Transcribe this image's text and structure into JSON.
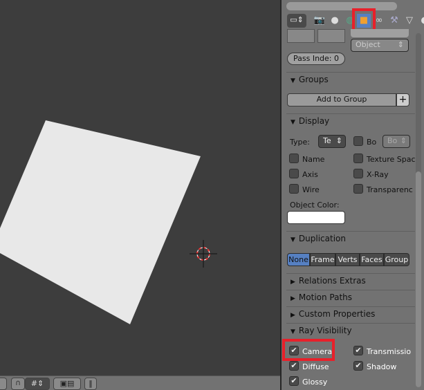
{
  "colors": {
    "viewport_bg": "#3d3d3d",
    "panel_bg": "#727272",
    "plane": "#e8e8e8",
    "active_blue": "#5680c2",
    "highlight": "#e8202a"
  },
  "toolbar_tabs": [
    "render-layers-icon",
    "render-icon",
    "scene-icon",
    "world-icon",
    "object-icon",
    "constraints-icon",
    "modifier-icon",
    "data-icon",
    "material-icon"
  ],
  "active_tab": "object-icon",
  "top": {
    "pass_index": "Pass Inde: 0",
    "parent_type": "Object"
  },
  "groups": {
    "title": "Groups",
    "add_button": "Add to Group",
    "add_icon": "+"
  },
  "display": {
    "title": "Display",
    "type_label": "Type:",
    "type_value": "Te",
    "bounds_label": "Bo",
    "bounds_value": "Bo",
    "checks": [
      {
        "label": "Name",
        "checked": false
      },
      {
        "label": "Texture Spac",
        "checked": false
      },
      {
        "label": "Axis",
        "checked": false
      },
      {
        "label": "X-Ray",
        "checked": false
      },
      {
        "label": "Wire",
        "checked": false
      },
      {
        "label": "Transparenc",
        "checked": false
      }
    ],
    "object_color_label": "Object Color:",
    "object_color": "#ffffff"
  },
  "duplication": {
    "title": "Duplication",
    "options": [
      "None",
      "Frame",
      "Verts",
      "Faces",
      "Group"
    ],
    "selected": "None"
  },
  "collapsed_sections": [
    "Relations Extras",
    "Motion Paths",
    "Custom Properties"
  ],
  "ray_visibility": {
    "title": "Ray Visibility",
    "checks": [
      {
        "label": "Camera",
        "checked": true
      },
      {
        "label": "Transmissio",
        "checked": true
      },
      {
        "label": "Diffuse",
        "checked": true
      },
      {
        "label": "Shadow",
        "checked": true
      },
      {
        "label": "Glossy",
        "checked": true
      }
    ]
  },
  "check_glyph": "✔",
  "triangle_down": "▼",
  "triangle_right": "▶"
}
